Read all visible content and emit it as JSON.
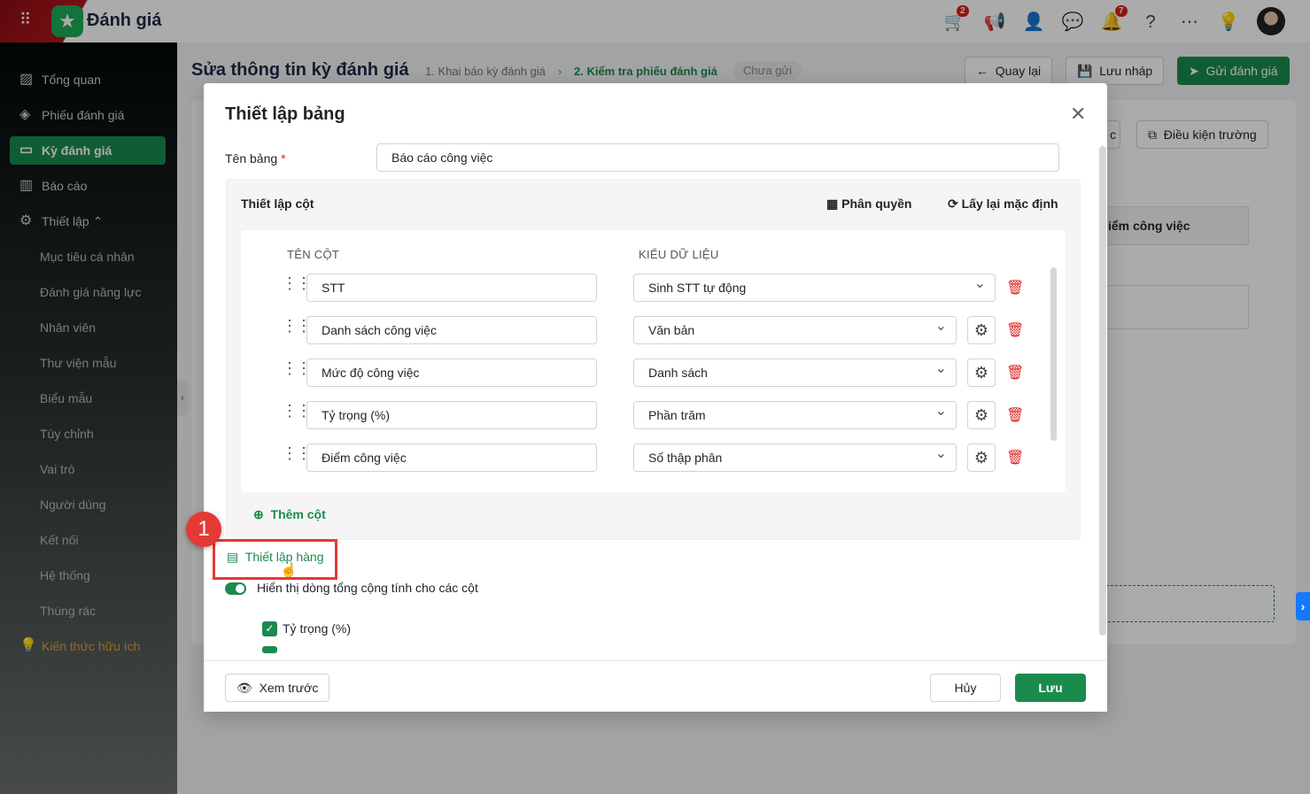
{
  "app": {
    "title": "Đánh giá",
    "cart_badge": "2",
    "bell_badge": "7"
  },
  "sidebar": {
    "items": [
      {
        "label": "Tổng quan",
        "icon": "chart-icon"
      },
      {
        "label": "Phiếu đánh giá",
        "icon": "layers-icon"
      },
      {
        "label": "Kỳ đánh giá",
        "icon": "presentation-icon",
        "active": true
      },
      {
        "label": "Báo cáo",
        "icon": "bar-chart-icon"
      },
      {
        "label": "Thiết lập",
        "icon": "gear-icon"
      }
    ],
    "sub_items": [
      "Mục tiêu cá nhân",
      "Đánh giá năng lực",
      "Nhân viên",
      "Thư viện mẫu",
      "Biểu mẫu",
      "Tùy chỉnh",
      "Vai trò",
      "Người dùng",
      "Kết nối",
      "Hệ thống",
      "Thùng rác"
    ],
    "knowledge": "Kiến thức hữu ích"
  },
  "header": {
    "title": "Sửa thông tin kỳ đánh giá",
    "step1": "1. Khai báo kỳ đánh giá",
    "step2": "2. Kiểm tra phiếu đánh giá",
    "status": "Chưa gửi",
    "back": "Quay lại",
    "draft": "Lưu nháp",
    "send": "Gửi đánh giá"
  },
  "background": {
    "btn_partial": "c",
    "field_conditions": "Điều kiện trường",
    "col_partial": "iểm công việc"
  },
  "modal": {
    "title": "Thiết lập bảng",
    "table_name_label": "Tên bảng",
    "table_name_value": "Báo cáo công việc",
    "columns_title": "Thiết lập cột",
    "permissions": "Phân quyền",
    "reset_default": "Lấy lại mặc định",
    "col_name_header": "TÊN CỘT",
    "col_type_header": "KIỂU DỮ LIỆU",
    "rows": [
      {
        "name": "STT",
        "type": "Sinh STT tự động"
      },
      {
        "name": "Danh sách công việc",
        "type": "Văn bản"
      },
      {
        "name": "Mức độ công việc",
        "type": "Danh sách"
      },
      {
        "name": "Tỷ trọng (%)",
        "type": "Phần trăm"
      },
      {
        "name": "Điểm công việc",
        "type": "Số thập phân"
      }
    ],
    "add_column": "Thêm cột",
    "row_settings": "Thiết lập hàng",
    "step_number": "1",
    "show_total": "Hiển thị dòng tổng cộng tính cho các cột",
    "checked": [
      "Tỷ trọng (%)"
    ],
    "preview": "Xem trước",
    "cancel": "Hủy",
    "save": "Lưu"
  }
}
